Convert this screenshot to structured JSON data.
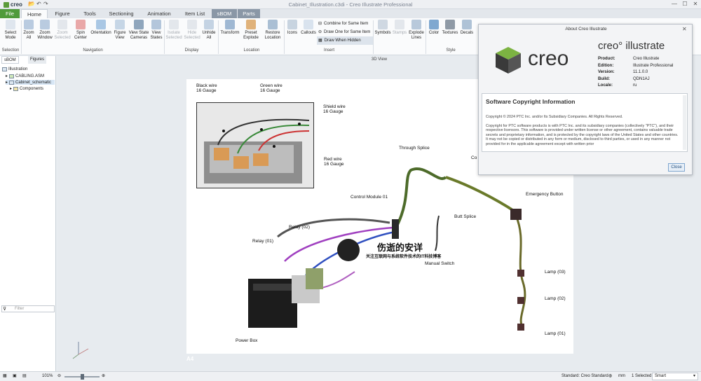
{
  "app": {
    "logo": "creo",
    "window_title": "Cabinet_Illustration.c3di - Creo Illustrate Professional"
  },
  "tabs": [
    "File",
    "Home",
    "Figure",
    "Tools",
    "Sectioning",
    "Animation",
    "Item List",
    "sBOM",
    "Parts"
  ],
  "ribbon": {
    "selection": {
      "group": "Selection",
      "buttons": [
        "Select\nMode"
      ]
    },
    "navigation": {
      "group": "Navigation",
      "buttons": [
        "Zoom\nAll",
        "Zoom\nWindow",
        "Zoom\nSelected",
        "Spin\nCenter",
        "Orientation",
        "Figure\nView",
        "View State\nCameras",
        "View\nStates"
      ]
    },
    "display": {
      "group": "Display",
      "buttons": [
        "Isolate\nSelected",
        "Hide\nSelected",
        "Unhide\nAll"
      ]
    },
    "location": {
      "group": "Location",
      "buttons": [
        "Transform",
        "Preset\nExplode",
        "Restore\nLocation"
      ]
    },
    "insert": {
      "group": "Insert",
      "buttons": [
        "Icons",
        "Callouts"
      ],
      "small": [
        "Combine for Same Item",
        "Draw One for Same Item",
        "Draw When Hidden"
      ]
    },
    "style": {
      "group": "Style",
      "buttons": [
        "Symbols",
        "Stamps",
        "Explode\nLines",
        "Color",
        "Textures",
        "Decals"
      ]
    }
  },
  "left_panel": {
    "tabs": [
      "sBOM",
      "Figures"
    ],
    "tree": [
      "Illustration",
      "CABLING.ASM",
      "Cabinet_schematic",
      "Components"
    ],
    "filter_placeholder": "Filter"
  },
  "view_header": "3D View",
  "paper_label": "A4",
  "callouts": {
    "black_wire": "Black wire\n16 Gauge",
    "green_wire": "Green wire\n16 Gauge",
    "shield_wire": "Shield wire\n16 Gauge",
    "red_wire": "Red wire\n16 Gauge",
    "through_splice": "Through Splice",
    "control_module": "Control Module 01",
    "butt_splice": "Butt Splice",
    "emergency_button": "Emergency Button",
    "relay_01": "Relay (01)",
    "relay_02": "Relay (02)",
    "manual_switch": "Manual Switch",
    "power_box": "Power Box",
    "lamp_03": "Lamp (03)",
    "lamp_02": "Lamp (02)",
    "lamp_01": "Lamp (01)",
    "co_partial": "Co"
  },
  "watermark": {
    "title": "伤逝的安详",
    "subtitle": "关注互联网与系统软件技术的IT科技博客"
  },
  "about": {
    "title": "About Creo Illustrate",
    "brand": "creo",
    "product_name": "creo° illustrate",
    "info": [
      [
        "Product:",
        "Creo Illustrate"
      ],
      [
        "Edition:",
        "Illustrate Professional"
      ],
      [
        "Version:",
        "11.1.0.0"
      ],
      [
        "Build:",
        "QDN1AJ"
      ],
      [
        "Locale:",
        "ru"
      ]
    ],
    "heading": "Software Copyright Information",
    "copyright": "Copyright © 2024 PTC Inc. and/or Its Subsidiary Companies. All Rights Reserved.",
    "body": "Copyright for PTC software products is with PTC Inc. and its subsidiary companies (collectively \"PTC\"), and their respective licensors. This software is provided under written license or other agreement, contains valuable trade secrets and proprietary information, and is protected by the copyright laws of the United States and other countries. It may not be copied or distributed in any form or medium, disclosed to third parties, or used in any manner not provided for in the applicable agreement except with written prior",
    "close": "Close"
  },
  "status": {
    "zoom": "101%",
    "standard": "Standard: Creo Standard",
    "units": "mm",
    "selected": "1 Selected",
    "mode": "Smart"
  }
}
